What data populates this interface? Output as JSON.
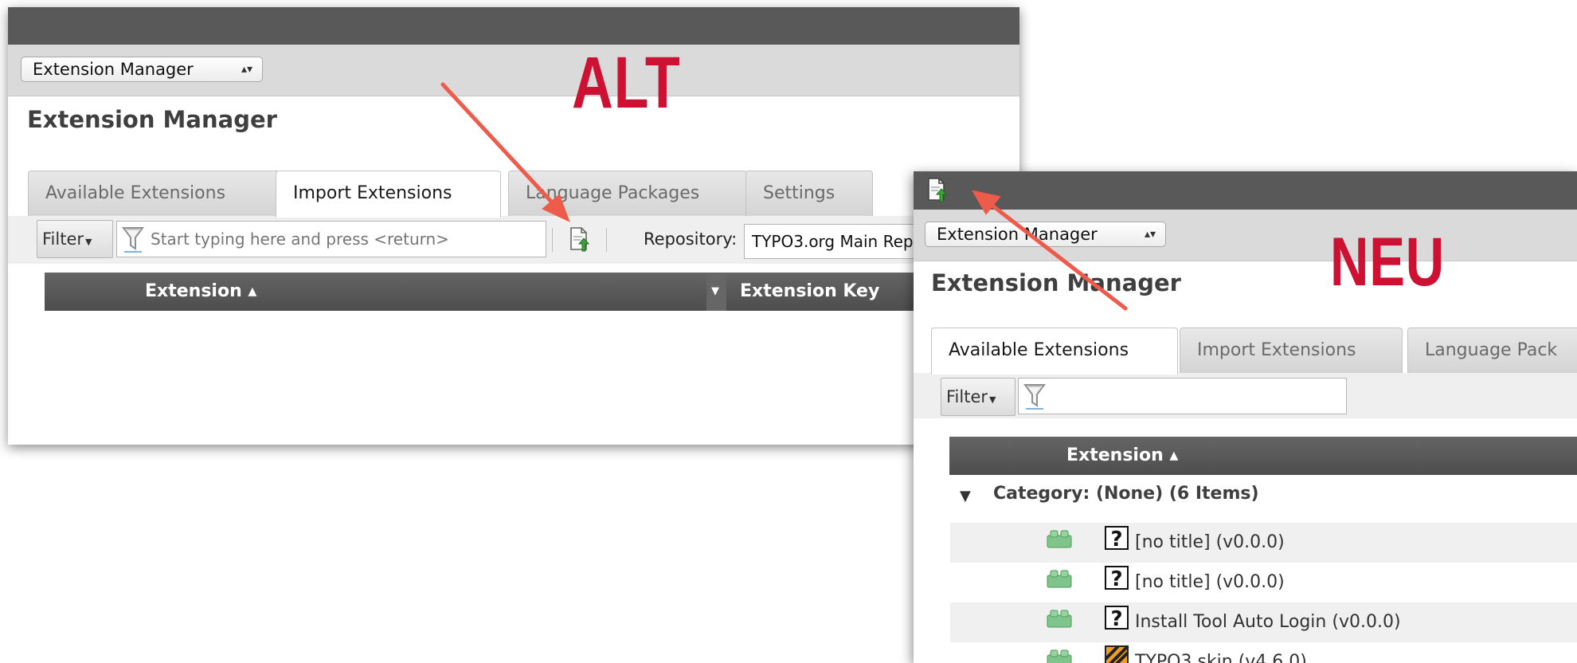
{
  "annotations": {
    "old_label": "ALT",
    "new_label": "NEU",
    "arrow_color": "#ee5b4a",
    "label_color": "#cc1133"
  },
  "old_window": {
    "module_select": "Extension Manager",
    "title": "Extension Manager",
    "tabs": [
      "Available Extensions",
      "Import Extensions",
      "Language Packages",
      "Settings"
    ],
    "active_tab": "Import Extensions",
    "filter_label": "Filter",
    "search_placeholder": "Start typing here and press <return>",
    "upload_icon": "upload-extension-icon",
    "repository_label": "Repository:",
    "repository_value": "TYPO3.org Main Rep",
    "columns": [
      "Extension ▴",
      "Extension Key"
    ]
  },
  "new_window": {
    "upload_icon": "upload-extension-icon",
    "module_select": "Extension Manager",
    "title": "Extension Manager",
    "tabs": [
      "Available Extensions",
      "Import Extensions",
      "Language Pack"
    ],
    "active_tab": "Available Extensions",
    "filter_label": "Filter",
    "search_placeholder": "",
    "columns": [
      "Extension ▴"
    ],
    "group": {
      "label": "Category: (None) (6 Items)",
      "expanded": true
    },
    "rows": [
      {
        "icon": "extension-brick-icon",
        "status_icon": "unknown-question-icon",
        "label": "[no title] (v0.0.0)"
      },
      {
        "icon": "extension-brick-icon",
        "status_icon": "unknown-question-icon",
        "label": "[no title] (v0.0.0)"
      },
      {
        "icon": "extension-brick-icon",
        "status_icon": "unknown-question-icon",
        "label": "Install Tool Auto Login (v0.0.0)"
      },
      {
        "icon": "extension-brick-icon",
        "status_icon": "alpha-striped-icon",
        "label": "TYPO3 skin (v4.6.0)"
      }
    ]
  }
}
